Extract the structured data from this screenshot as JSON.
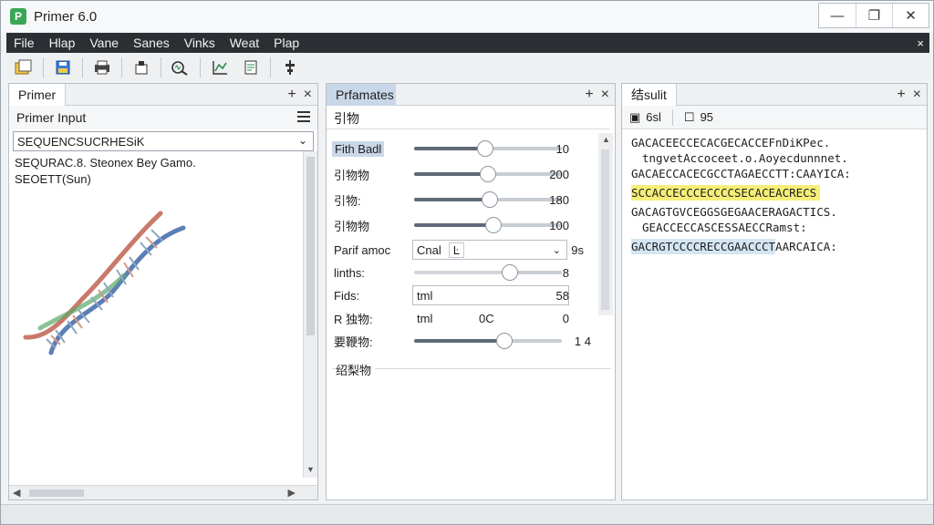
{
  "app": {
    "title": "Primer 6.0",
    "icon_name": "primer-app-icon"
  },
  "window_controls": {
    "minimize": "—",
    "maximize": "❐",
    "close": "✕"
  },
  "menu": {
    "items": [
      "File",
      "Hlap",
      "Vane",
      "Sanes",
      "Vinks",
      "Weat",
      "Plap"
    ],
    "close": "×"
  },
  "toolbar": {
    "buttons": [
      "open-folder-icon",
      "save-icon",
      "print-icon",
      "export-icon",
      "analyze-icon",
      "graph-icon",
      "report-icon",
      "align-icon"
    ]
  },
  "primer_panel": {
    "tab": "Primer",
    "add": "+",
    "close": "×",
    "subheader": "Primer Input",
    "sequence_select": "SEQUENCSUCRHESiK",
    "lines": [
      "SEQURAC.8. Steonex Bey Gamo.",
      "SEOETT(Sun)"
    ]
  },
  "params_panel": {
    "tab": "Prfamates",
    "add": "+",
    "close": "×",
    "section": "引物",
    "section_bottom": "绍梨物",
    "rows": [
      {
        "label": "Fith Badl",
        "value": "10",
        "slider": 0.48
      },
      {
        "label": "引物物",
        "value": "200",
        "slider": 0.5
      },
      {
        "label": "引物:",
        "value": "180",
        "slider": 0.51
      },
      {
        "label": "引物物",
        "value": "100",
        "slider": 0.54
      },
      {
        "label": "Parif amoc",
        "dropdown": "Cnal",
        "dropdown_icon": "Ŀ",
        "value": "9s"
      },
      {
        "label": "linths:",
        "value": "8",
        "slider": 0.65
      },
      {
        "label": "Fids:",
        "input": "tml",
        "value": "58"
      },
      {
        "label": "R 独物:",
        "input": "tml",
        "input2": "0C",
        "value": "0"
      },
      {
        "label": "要鞭物:",
        "value": "1  4",
        "slider": 0.61
      }
    ]
  },
  "results_panel": {
    "tab": "结sulit",
    "add": "+",
    "close": "×",
    "tool1": "6sl",
    "tool2": "95",
    "lines": [
      {
        "text": "GACACEECCECACGECACCEFnDiKPec.",
        "style": ""
      },
      {
        "text": "tngvetAccoceet.o.Aoyecdunnnet.",
        "style": "ind"
      },
      {
        "text": "GACAECCACECGCCTAGAECCTT:CAAYICA:",
        "style": ""
      },
      {
        "text": "SCCACCECCCECCCCSECACEACRECS",
        "style": "y"
      },
      {
        "text": "GACAGTGVCEGGSGEGAACERAGACTICS.",
        "style": ""
      },
      {
        "text": "GEACCECCASCESSAECCRamst:",
        "style": "ind"
      },
      {
        "text": "GACRGTCCCCRECCGAACCCT",
        "style": "b",
        "tail": "AARCAICA:"
      }
    ]
  }
}
